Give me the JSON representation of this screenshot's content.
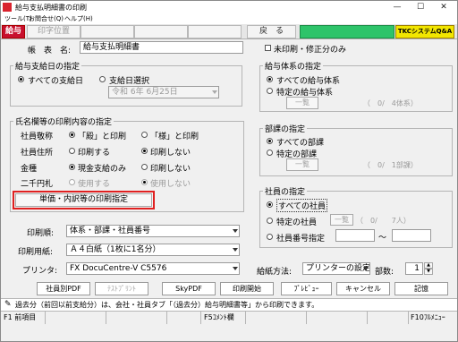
{
  "window": {
    "title": "給与支払明細書の印刷",
    "minimize": "—",
    "maximize": "☐",
    "close": "✕"
  },
  "menu": [
    "ツール(T)",
    "お問合せ(Q)",
    "ヘルプ(H)"
  ],
  "toolbar": {
    "mode": "給与",
    "font_button": "印字位置",
    "back": "戻　る",
    "logo": "TKCシステムQ&A"
  },
  "form_name": {
    "label": "帳　表　名:",
    "value": "給与支払明細書"
  },
  "pay_date": {
    "title": "給与支給日の指定",
    "opt_all": "すべての支給日",
    "opt_select": "支給日選択",
    "date_value": "令和 6年 6月25日",
    "selected": "all"
  },
  "name_print": {
    "title": "氏名欄等の印刷内容の指定",
    "rows": [
      {
        "label": "社員敬称",
        "opt1": "「殿」と印刷",
        "opt2": "「様」と印刷",
        "selected": 1,
        "disabled": false
      },
      {
        "label": "社員住所",
        "opt1": "印刷する",
        "opt2": "印刷しない",
        "selected": 2,
        "disabled": false
      },
      {
        "label": "金種",
        "opt1": "現金支給のみ",
        "opt2": "印刷しない",
        "selected": 1,
        "disabled": false
      },
      {
        "label": "二千円札",
        "opt1": "使用する",
        "opt2": "使用しない",
        "selected": 2,
        "disabled": true
      }
    ],
    "detail_button": "単価・内訳等の印刷指定"
  },
  "print_order": {
    "label": "印刷順:",
    "value": "体系・部課・社員番号"
  },
  "paper": {
    "label": "印刷用紙:",
    "value": "Ａ４白紙（1枚に1名分）"
  },
  "printer": {
    "label": "プリンタ:",
    "value": "FX DocuCentre-V C5576"
  },
  "unprinted": {
    "label": "未印刷・修正分のみ",
    "checked": false
  },
  "pay_system": {
    "title": "給与体系の指定",
    "opt_all": "すべての給与体系",
    "opt_specific": "特定の給与体系",
    "button": "一覧",
    "count": "（　0/　4体系）",
    "selected": "all"
  },
  "department": {
    "title": "部課の指定",
    "opt_all": "すべての部課",
    "opt_specific": "特定の部課",
    "button": "一覧",
    "count": "（　0/　1部課）",
    "selected": "all"
  },
  "employee": {
    "title": "社員の指定",
    "opt_all": "すべての社員",
    "opt_specific": "特定の社員",
    "opt_number": "社員番号指定",
    "button": "一覧",
    "count": "（　0/　　7人）",
    "range_sep": "〜",
    "selected": "all"
  },
  "feed": {
    "label": "給紙方法:",
    "value": "プリンターの設定"
  },
  "copies": {
    "label": "部数:",
    "value": "1"
  },
  "buttons": {
    "by_employee_pdf": "社員別PDF",
    "test_print": "ﾃｽﾄﾌﾟﾘﾝﾄ",
    "sky_pdf": "SkyPDF",
    "start_print": "印刷開始",
    "preview": "ﾌﾟﾚﾋﾞｭｰ",
    "cancel": "キャンセル",
    "memo": "記憶"
  },
  "message": "過去分（前回以前支給分）は、会社・社員タブ「（過去分）給与明細書等」から印刷できます。",
  "fkeys": {
    "f1": "F1 前項目",
    "f5": "F5ｺﾒﾝﾄ欄",
    "f10": "F10ﾌﾙﾒﾆｭｰ"
  },
  "colors": {
    "highlight": "#e02020",
    "logo_bg": "#f2e600",
    "mode_bg": "#c8102e",
    "toolbar_green": "#2ec46a"
  }
}
